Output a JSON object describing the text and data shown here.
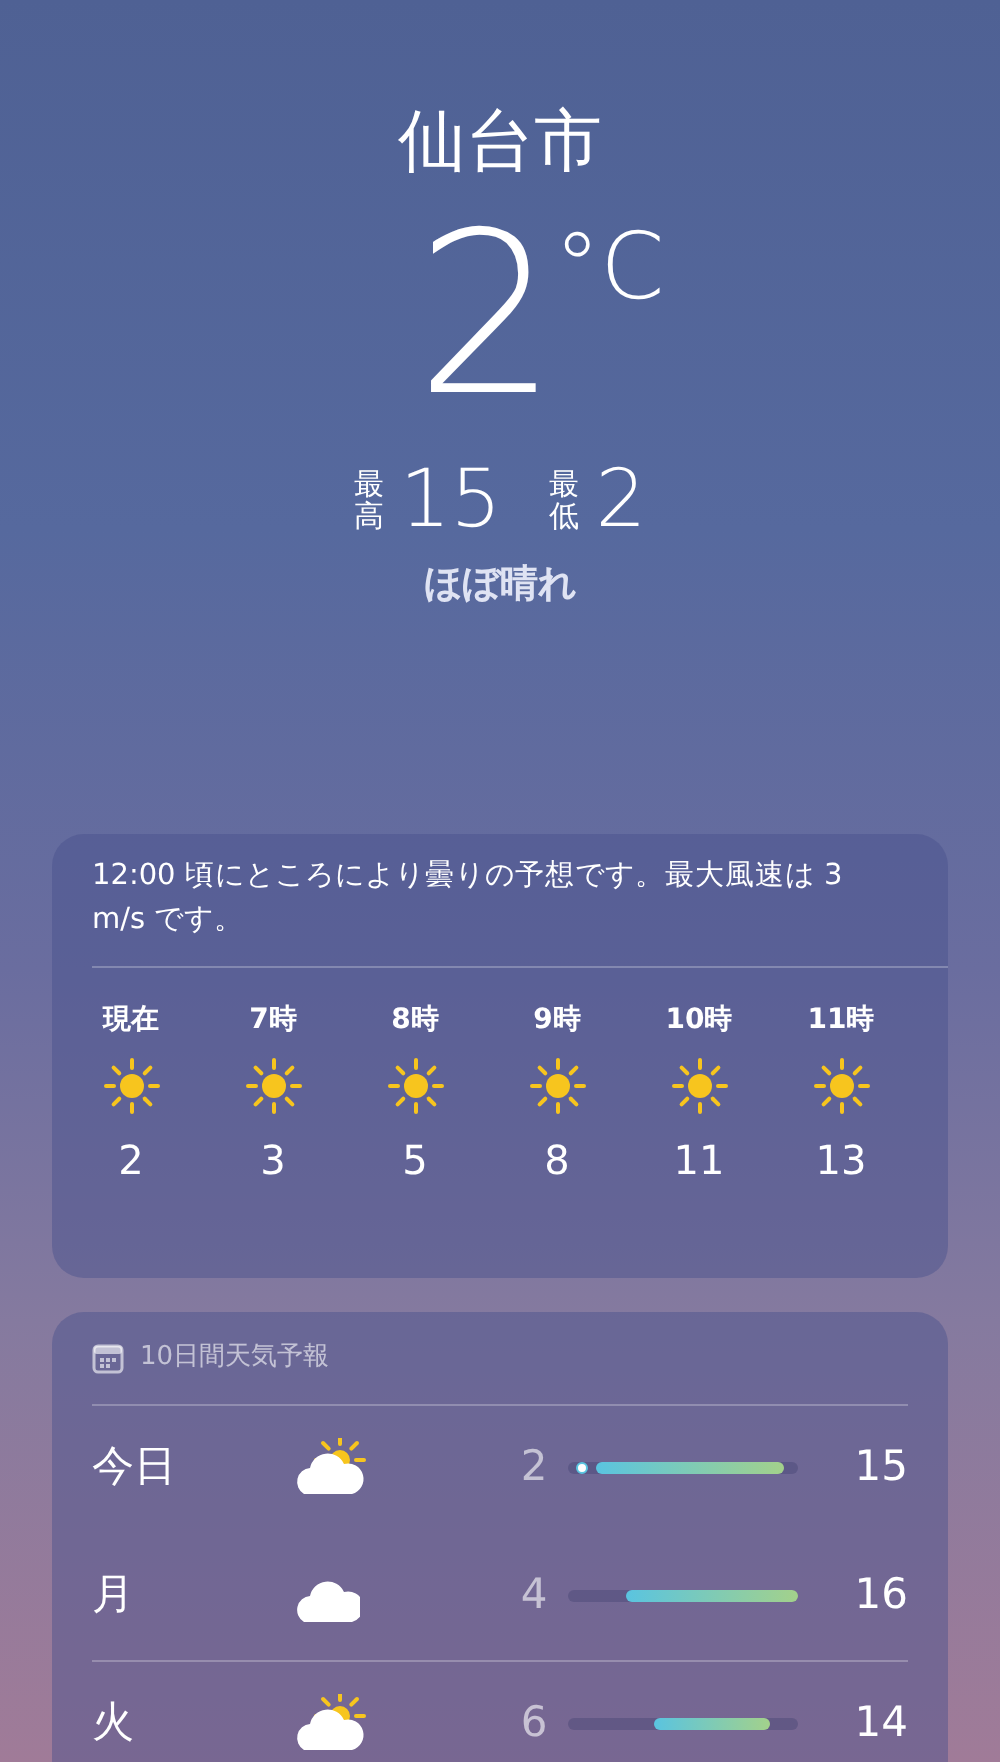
{
  "location": {
    "city": "仙台市",
    "temperature": "2",
    "unit": "°C",
    "high_label": "最高",
    "high": "15",
    "low_label": "最低",
    "low": "2",
    "condition": "ほぼ晴れ"
  },
  "hourly": {
    "summary": "12:00 頃にところにより曇りの予想です。最大風速は 3 m/s です。",
    "hours": [
      {
        "time": "現在",
        "kind": "sun",
        "temp": "2"
      },
      {
        "time": "7時",
        "kind": "sun",
        "temp": "3"
      },
      {
        "time": "8時",
        "kind": "sun",
        "temp": "5"
      },
      {
        "time": "9時",
        "kind": "sun",
        "temp": "8"
      },
      {
        "time": "10時",
        "kind": "sun",
        "temp": "11"
      },
      {
        "time": "11時",
        "kind": "sun",
        "temp": "13"
      }
    ]
  },
  "daily": {
    "title": "10日間天気予報",
    "days": [
      {
        "day": "今日",
        "kind": "partly_cloudy",
        "low": "2",
        "high": "15",
        "current": {
          "level": 0.06
        }
      },
      {
        "day": "月",
        "kind": "cloud",
        "low": "4",
        "high": "16"
      },
      {
        "day": "火",
        "kind": "partly_cloudy",
        "low": "6",
        "high": "14"
      }
    ]
  }
}
